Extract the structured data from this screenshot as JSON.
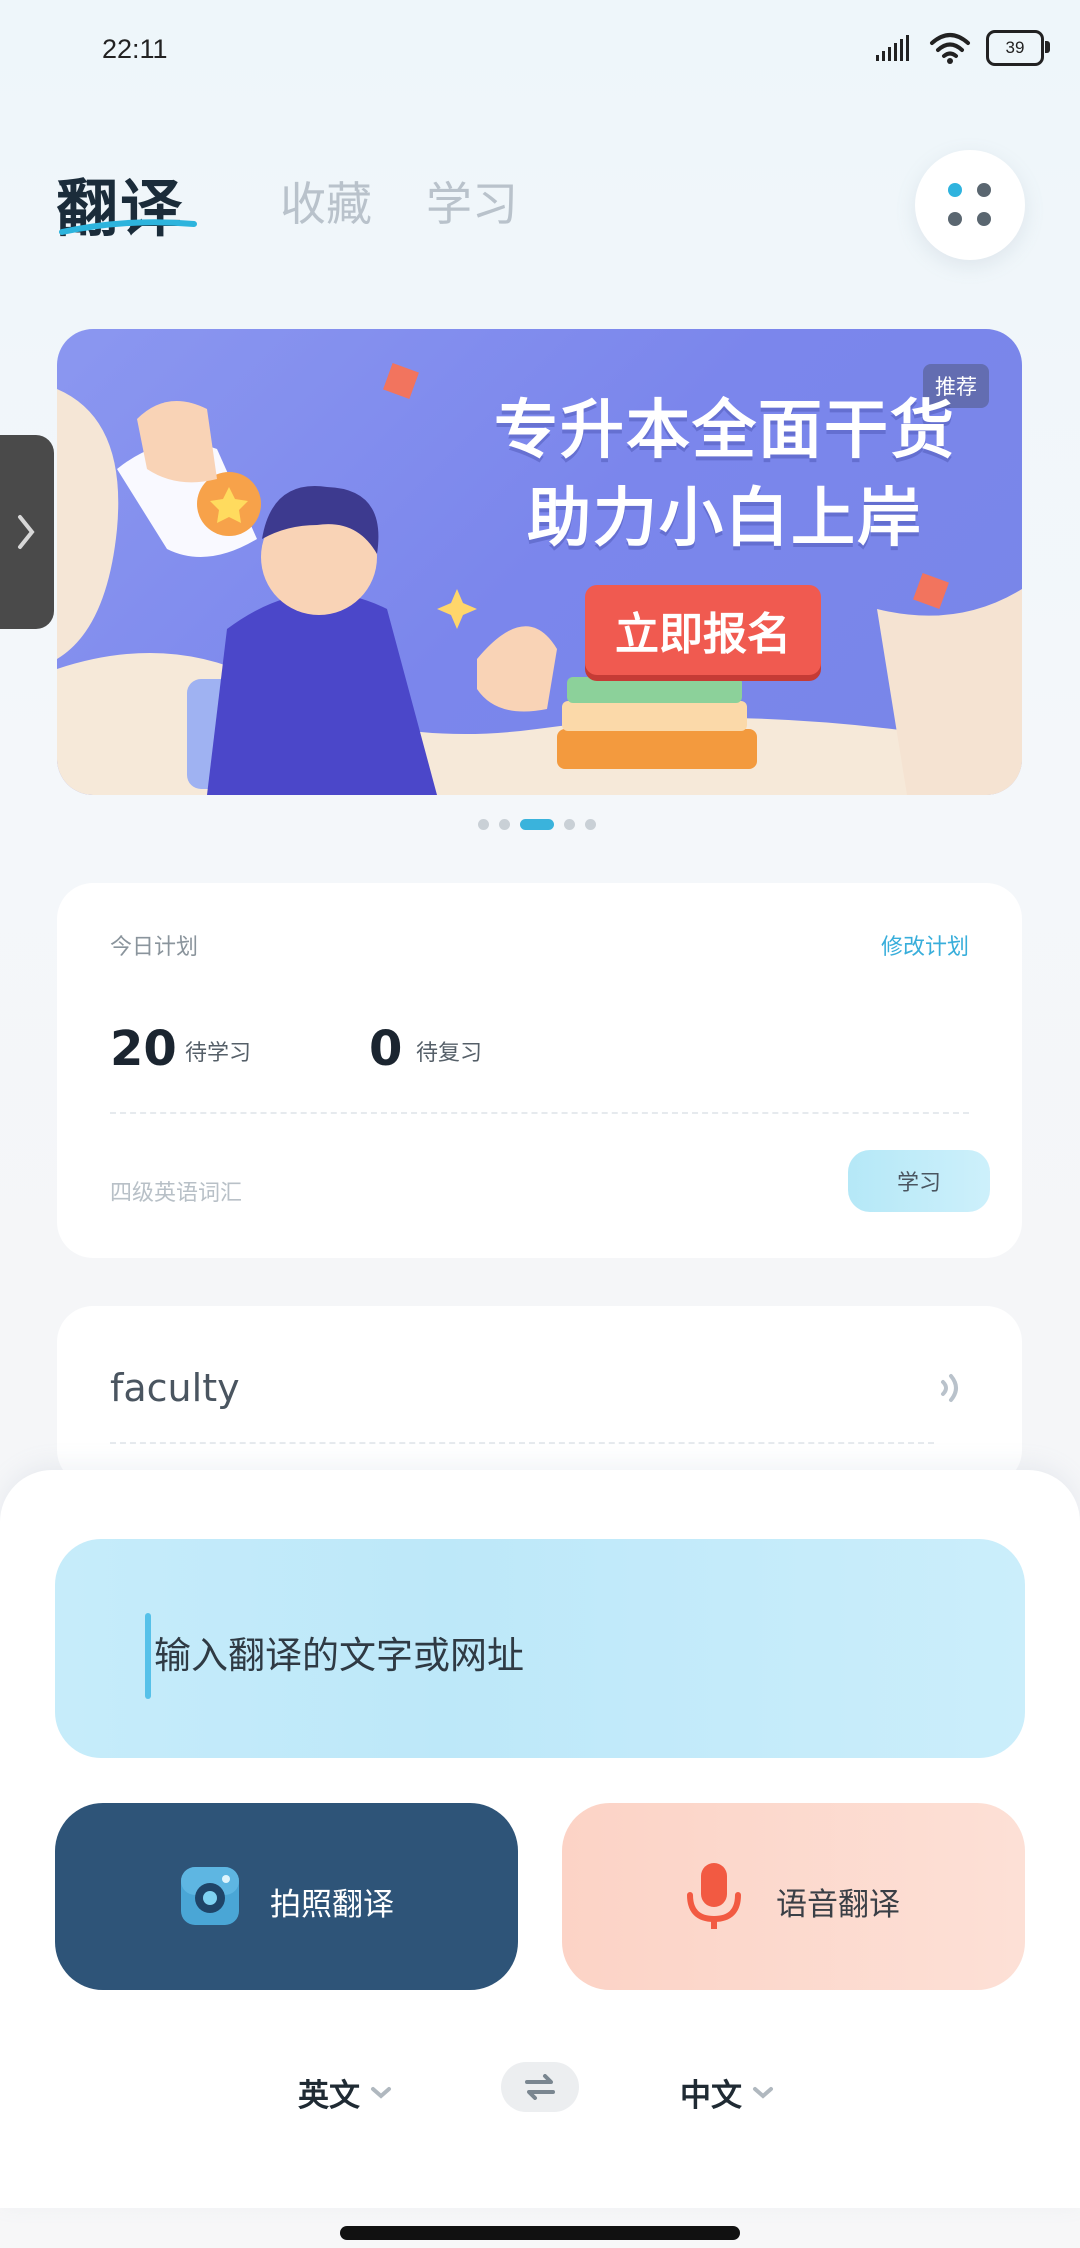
{
  "status_bar": {
    "time": "22:11",
    "battery": "39"
  },
  "nav": {
    "tabs": [
      {
        "label": "翻译"
      },
      {
        "label": "收藏"
      },
      {
        "label": "学习"
      }
    ]
  },
  "banner": {
    "badge": "推荐",
    "title_line1": "专升本全面干货",
    "title_line2": "助力小白上岸",
    "cta": "立即报名",
    "page_count": 5,
    "active_page": 3
  },
  "plan": {
    "title": "今日计划",
    "edit_label": "修改计划",
    "to_learn_count": "20",
    "to_learn_label": "待学习",
    "to_review_count": "0",
    "to_review_label": "待复习",
    "book": "四级英语词汇",
    "learn_button": "学习"
  },
  "word_card": {
    "word": "faculty"
  },
  "translator": {
    "input_placeholder": "输入翻译的文字或网址",
    "photo_button": "拍照翻译",
    "voice_button": "语音翻译",
    "source_lang": "英文",
    "target_lang": "中文"
  },
  "colors": {
    "accent": "#3ab3dc",
    "photo_button": "#2e5478",
    "voice_button": "#fcd3c6",
    "cta": "#f05a50"
  },
  "icons": [
    "signal-icon",
    "wifi-icon",
    "battery-icon",
    "menu-dots-icon",
    "chevron-right-icon",
    "speaker-icon",
    "camera-icon",
    "microphone-icon",
    "chevron-down-icon",
    "swap-icon"
  ]
}
